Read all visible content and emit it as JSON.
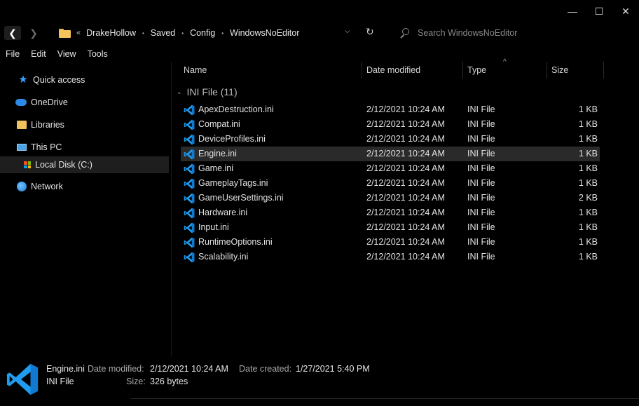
{
  "window": {
    "minimize_glyph": "—",
    "maximize_glyph": "☐",
    "close_glyph": "✕"
  },
  "nav": {
    "back_glyph": "❮",
    "forward_glyph": "❯",
    "lead_glyph": "«",
    "breadcrumbs": [
      "DrakeHollow",
      "Saved",
      "Config",
      "WindowsNoEditor"
    ],
    "separator": "•",
    "dropdown_glyph": "⌵",
    "refresh_glyph": "↻",
    "search_placeholder": "Search WindowsNoEditor"
  },
  "menu": [
    "File",
    "Edit",
    "View",
    "Tools"
  ],
  "sidebar": {
    "items": [
      {
        "label": "Quick access",
        "icon": "star-icon"
      },
      {
        "label": "OneDrive",
        "icon": "cloud-icon"
      },
      {
        "label": "Libraries",
        "icon": "library-icon"
      },
      {
        "label": "This PC",
        "icon": "pc-icon"
      },
      {
        "label": "Local Disk (C:)",
        "icon": "drive-icon"
      },
      {
        "label": "Network",
        "icon": "network-icon"
      }
    ]
  },
  "columns": {
    "name": "Name",
    "date": "Date modified",
    "type": "Type",
    "size": "Size"
  },
  "group": {
    "label": "INI File (11)",
    "chevron": "⌄"
  },
  "files": [
    {
      "name": "ApexDestruction.ini",
      "date": "2/12/2021 10:24 AM",
      "type": "INI File",
      "size": "1 KB"
    },
    {
      "name": "Compat.ini",
      "date": "2/12/2021 10:24 AM",
      "type": "INI File",
      "size": "1 KB"
    },
    {
      "name": "DeviceProfiles.ini",
      "date": "2/12/2021 10:24 AM",
      "type": "INI File",
      "size": "1 KB"
    },
    {
      "name": "Engine.ini",
      "date": "2/12/2021 10:24 AM",
      "type": "INI File",
      "size": "1 KB"
    },
    {
      "name": "Game.ini",
      "date": "2/12/2021 10:24 AM",
      "type": "INI File",
      "size": "1 KB"
    },
    {
      "name": "GameplayTags.ini",
      "date": "2/12/2021 10:24 AM",
      "type": "INI File",
      "size": "1 KB"
    },
    {
      "name": "GameUserSettings.ini",
      "date": "2/12/2021 10:24 AM",
      "type": "INI File",
      "size": "2 KB"
    },
    {
      "name": "Hardware.ini",
      "date": "2/12/2021 10:24 AM",
      "type": "INI File",
      "size": "1 KB"
    },
    {
      "name": "Input.ini",
      "date": "2/12/2021 10:24 AM",
      "type": "INI File",
      "size": "1 KB"
    },
    {
      "name": "RuntimeOptions.ini",
      "date": "2/12/2021 10:24 AM",
      "type": "INI File",
      "size": "1 KB"
    },
    {
      "name": "Scalability.ini",
      "date": "2/12/2021 10:24 AM",
      "type": "INI File",
      "size": "1 KB"
    }
  ],
  "details": {
    "filename": "Engine.ini",
    "filetype": "INI File",
    "modified_label": "Date modified:",
    "modified_value": "2/12/2021 10:24 AM",
    "created_label": "Date created:",
    "created_value": "1/27/2021 5:40 PM",
    "size_label": "Size:",
    "size_value": "326 bytes"
  },
  "colors": {
    "background": "#000000",
    "selected_row": "#2a2a2a",
    "vscode_blue": "#1f9cf0",
    "folder_yellow": "#f5c35b"
  }
}
